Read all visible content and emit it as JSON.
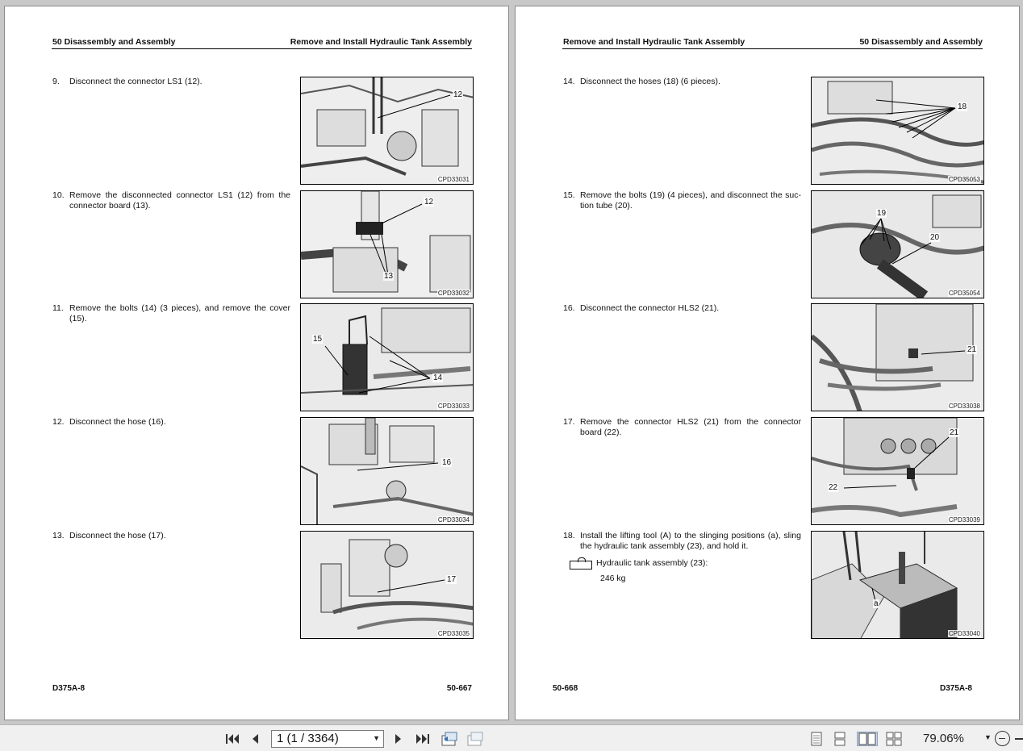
{
  "viewer": {
    "left_page": {
      "header_left": "50 Disassembly and Assembly",
      "header_right": "Remove and Install Hydraulic Tank Assembly",
      "footer_left": "D375A-8",
      "footer_right": "50-667",
      "steps": [
        {
          "num": "9.",
          "text": "Disconnect the connector LS1 (12).",
          "figure": "CPD33031",
          "callouts": [
            "12"
          ]
        },
        {
          "num": "10.",
          "text": "Remove the disconnected connector LS1 (12) from the connector board (13).",
          "figure": "CPD33032",
          "callouts": [
            "12",
            "13"
          ]
        },
        {
          "num": "11.",
          "text": "Remove the bolts (14) (3 pieces), and remove the cover (15).",
          "figure": "CPD33033",
          "callouts": [
            "15",
            "14"
          ]
        },
        {
          "num": "12.",
          "text": "Disconnect the hose (16).",
          "figure": "CPD33034",
          "callouts": [
            "16"
          ]
        },
        {
          "num": "13.",
          "text": "Disconnect the hose (17).",
          "figure": "CPD33035",
          "callouts": [
            "17"
          ]
        }
      ]
    },
    "right_page": {
      "header_left": "Remove and Install Hydraulic Tank Assembly",
      "header_right": "50 Disassembly and Assembly",
      "footer_left": "50-668",
      "footer_right": "D375A-8",
      "steps": [
        {
          "num": "14.",
          "text": "Disconnect the hoses (18) (6 pieces).",
          "figure": "CPD35053",
          "callouts": [
            "18"
          ]
        },
        {
          "num": "15.",
          "text": "Remove the bolts (19) (4 pieces), and disconnect the suc-tion tube (20).",
          "figure": "CPD35054",
          "callouts": [
            "19",
            "20"
          ]
        },
        {
          "num": "16.",
          "text": "Disconnect the connector HLS2 (21).",
          "figure": "CPD33038",
          "callouts": [
            "21"
          ]
        },
        {
          "num": "17.",
          "text": "Remove the connector HLS2 (21) from the connector board (22).",
          "figure": "CPD33039",
          "callouts": [
            "21",
            "22"
          ]
        },
        {
          "num": "18.",
          "text": "Install the lifting tool (A) to the slinging positions (a), sling the hydraulic tank assembly (23), and hold it.",
          "figure": "CPD33040",
          "callouts": [
            "a"
          ]
        }
      ],
      "weight_label": "Hydraulic tank assembly (23):",
      "weight_value": "246 kg"
    }
  },
  "toolbar": {
    "page_field_value": "1 (1 / 3364)",
    "zoom_value": "79.06%",
    "icons": [
      "first-page-icon",
      "prev-page-icon",
      "next-page-icon",
      "last-page-icon",
      "previous-view-icon",
      "next-view-icon",
      "single-page-view-icon",
      "continuous-view-icon",
      "facing-view-icon",
      "continuous-facing-view-icon",
      "zoom-out-icon"
    ]
  }
}
